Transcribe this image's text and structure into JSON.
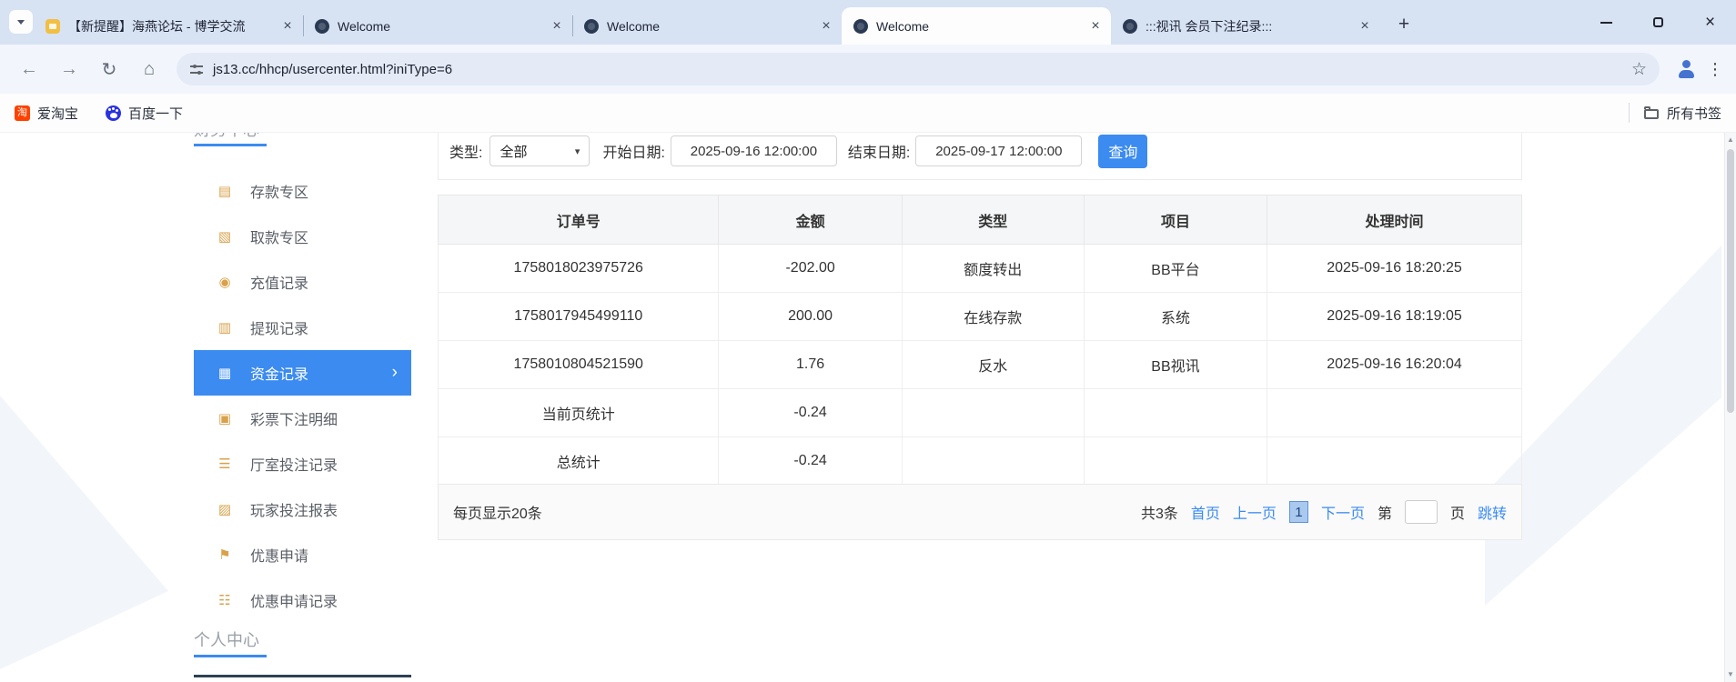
{
  "browser": {
    "tabs": [
      {
        "id": "forum",
        "title": "【新提醒】海燕论坛 - 博学交流",
        "favicon": "forum-favicon-icon",
        "active": false
      },
      {
        "id": "welcome-1",
        "title": "Welcome",
        "favicon": "site-favicon-icon",
        "active": false
      },
      {
        "id": "welcome-2",
        "title": "Welcome",
        "favicon": "site-favicon-icon",
        "active": false
      },
      {
        "id": "welcome-3",
        "title": "Welcome",
        "favicon": "site-favicon-icon",
        "active": true
      },
      {
        "id": "betting-record",
        "title": ":::视讯 会员下注纪录:::",
        "favicon": "site-favicon-icon",
        "active": false
      }
    ],
    "url": "js13.cc/hhcp/usercenter.html?iniType=6",
    "bookmarks": [
      {
        "label": "爱淘宝",
        "icon": "taobao-icon",
        "glyph": "淘"
      },
      {
        "label": "百度一下",
        "icon": "baidu-paw-icon",
        "glyph": ""
      }
    ],
    "all_bookmarks_label": "所有书签"
  },
  "icons": {
    "back": "←",
    "forward": "→",
    "reload": "↻",
    "home": "⌂",
    "star": "☆",
    "menu_dots": "⋮",
    "new_tab": "+",
    "close": "×",
    "chevron_right": "›",
    "dropdown": "▾",
    "scroll_up": "▲",
    "scroll_down": "▼"
  },
  "colors": {
    "accent_blue": "#3b8bf0",
    "sidebar_icon_orange": "#d9a24a",
    "link_blue": "#3b8bf0",
    "active_item_bg": "#3b8bf0",
    "tabstrip_bg": "#d7e2f3"
  },
  "sidebar": {
    "top_section": "财务中心",
    "items": [
      {
        "id": "deposit",
        "label": "存款专区",
        "icon": "deposit-icon",
        "glyph": "▤",
        "active": false
      },
      {
        "id": "withdraw",
        "label": "取款专区",
        "icon": "withdraw-icon",
        "glyph": "▧",
        "active": false
      },
      {
        "id": "recharge-record",
        "label": "充值记录",
        "icon": "recharge-record-icon",
        "glyph": "◉",
        "active": false
      },
      {
        "id": "withdraw-record",
        "label": "提现记录",
        "icon": "withdraw-record-icon",
        "glyph": "▥",
        "active": false
      },
      {
        "id": "funds-record",
        "label": "资金记录",
        "icon": "funds-record-icon",
        "glyph": "▦",
        "active": true
      },
      {
        "id": "lottery-bet-detail",
        "label": "彩票下注明细",
        "icon": "lottery-bet-detail-icon",
        "glyph": "▣",
        "active": false
      },
      {
        "id": "hall-bet-record",
        "label": "厅室投注记录",
        "icon": "hall-bet-record-icon",
        "glyph": "☰",
        "active": false
      },
      {
        "id": "player-bet-report",
        "label": "玩家投注报表",
        "icon": "player-bet-report-icon",
        "glyph": "▨",
        "active": false
      },
      {
        "id": "promo-apply",
        "label": "优惠申请",
        "icon": "promo-apply-icon",
        "glyph": "⚑",
        "active": false
      },
      {
        "id": "promo-apply-record",
        "label": "优惠申请记录",
        "icon": "promo-apply-record-icon",
        "glyph": "☷",
        "active": false
      }
    ],
    "bottom_section": "个人中心"
  },
  "filters": {
    "type_label": "类型:",
    "type_value": "全部",
    "start_label": "开始日期:",
    "start_value": "2025-09-16 12:00:00",
    "end_label": "结束日期:",
    "end_value": "2025-09-17 12:00:00",
    "query_button": "查询"
  },
  "table": {
    "headers": [
      "订单号",
      "金额",
      "类型",
      "项目",
      "处理时间"
    ],
    "rows": [
      [
        "1758018023975726",
        "-202.00",
        "额度转出",
        "BB平台",
        "2025-09-16 18:20:25"
      ],
      [
        "1758017945499110",
        "200.00",
        "在线存款",
        "系统",
        "2025-09-16 18:19:05"
      ],
      [
        "1758010804521590",
        "1.76",
        "反水",
        "BB视讯",
        "2025-09-16 16:20:04"
      ],
      [
        "当前页统计",
        "-0.24",
        "",
        "",
        ""
      ],
      [
        "总统计",
        "-0.24",
        "",
        "",
        ""
      ]
    ]
  },
  "pagination": {
    "page_size_text": "每页显示20条",
    "total_text": "共3条",
    "first_label": "首页",
    "prev_label": "上一页",
    "current_page": "1",
    "next_label": "下一页",
    "jump_prefix": "第",
    "jump_suffix": "页",
    "jump_button": "跳转",
    "jump_value": ""
  }
}
